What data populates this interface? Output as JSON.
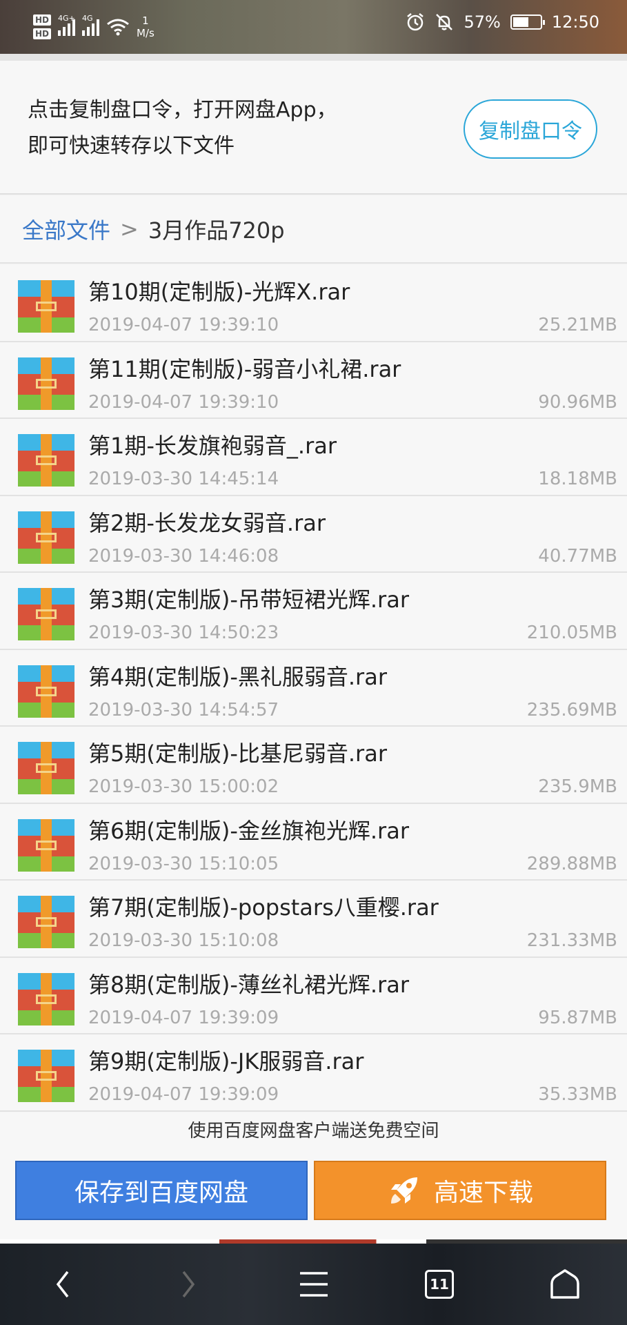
{
  "status_bar": {
    "hd1": "HD",
    "hd2": "HD",
    "net1": "4G+",
    "net2": "4G",
    "speed_value": "1",
    "speed_unit": "M/s",
    "battery_percent": "57%",
    "battery_level": 0.57,
    "time": "12:50"
  },
  "copy_section": {
    "line1": "点击复制盘口令，打开网盘App，",
    "line2": "即可快速转存以下文件",
    "button_label": "复制盘口令"
  },
  "breadcrumb": {
    "root": "全部文件",
    "separator": ">",
    "current": "3月作品720p"
  },
  "files": [
    {
      "name": "第10期(定制版)-光辉X.rar",
      "date": "2019-04-07 19:39:10",
      "size": "25.21MB"
    },
    {
      "name": "第11期(定制版)-弱音小礼裙.rar",
      "date": "2019-04-07 19:39:10",
      "size": "90.96MB"
    },
    {
      "name": "第1期-长发旗袍弱音_.rar",
      "date": "2019-03-30 14:45:14",
      "size": "18.18MB"
    },
    {
      "name": "第2期-长发龙女弱音.rar",
      "date": "2019-03-30 14:46:08",
      "size": "40.77MB"
    },
    {
      "name": "第3期(定制版)-吊带短裙光辉.rar",
      "date": "2019-03-30 14:50:23",
      "size": "210.05MB"
    },
    {
      "name": "第4期(定制版)-黑礼服弱音.rar",
      "date": "2019-03-30 14:54:57",
      "size": "235.69MB"
    },
    {
      "name": "第5期(定制版)-比基尼弱音.rar",
      "date": "2019-03-30 15:00:02",
      "size": "235.9MB"
    },
    {
      "name": "第6期(定制版)-金丝旗袍光辉.rar",
      "date": "2019-03-30 15:10:05",
      "size": "289.88MB"
    },
    {
      "name": "第7期(定制版)-popstars八重樱.rar",
      "date": "2019-03-30 15:10:08",
      "size": "231.33MB"
    },
    {
      "name": "第8期(定制版)-薄丝礼裙光辉.rar",
      "date": "2019-04-07 19:39:09",
      "size": "95.87MB"
    },
    {
      "name": "第9期(定制版)-JK服弱音.rar",
      "date": "2019-04-07 19:39:09",
      "size": "35.33MB"
    }
  ],
  "promo_text": "使用百度网盘客户端送免费空间",
  "actions": {
    "save_label": "保存到百度网盘",
    "download_label": "高速下载"
  },
  "nav": {
    "tab_count": "11"
  },
  "colors": {
    "accent_blue": "#3a78c8",
    "copy_button": "#2aa6d8",
    "save_button": "#3f7fe0",
    "download_button": "#f3922b"
  }
}
